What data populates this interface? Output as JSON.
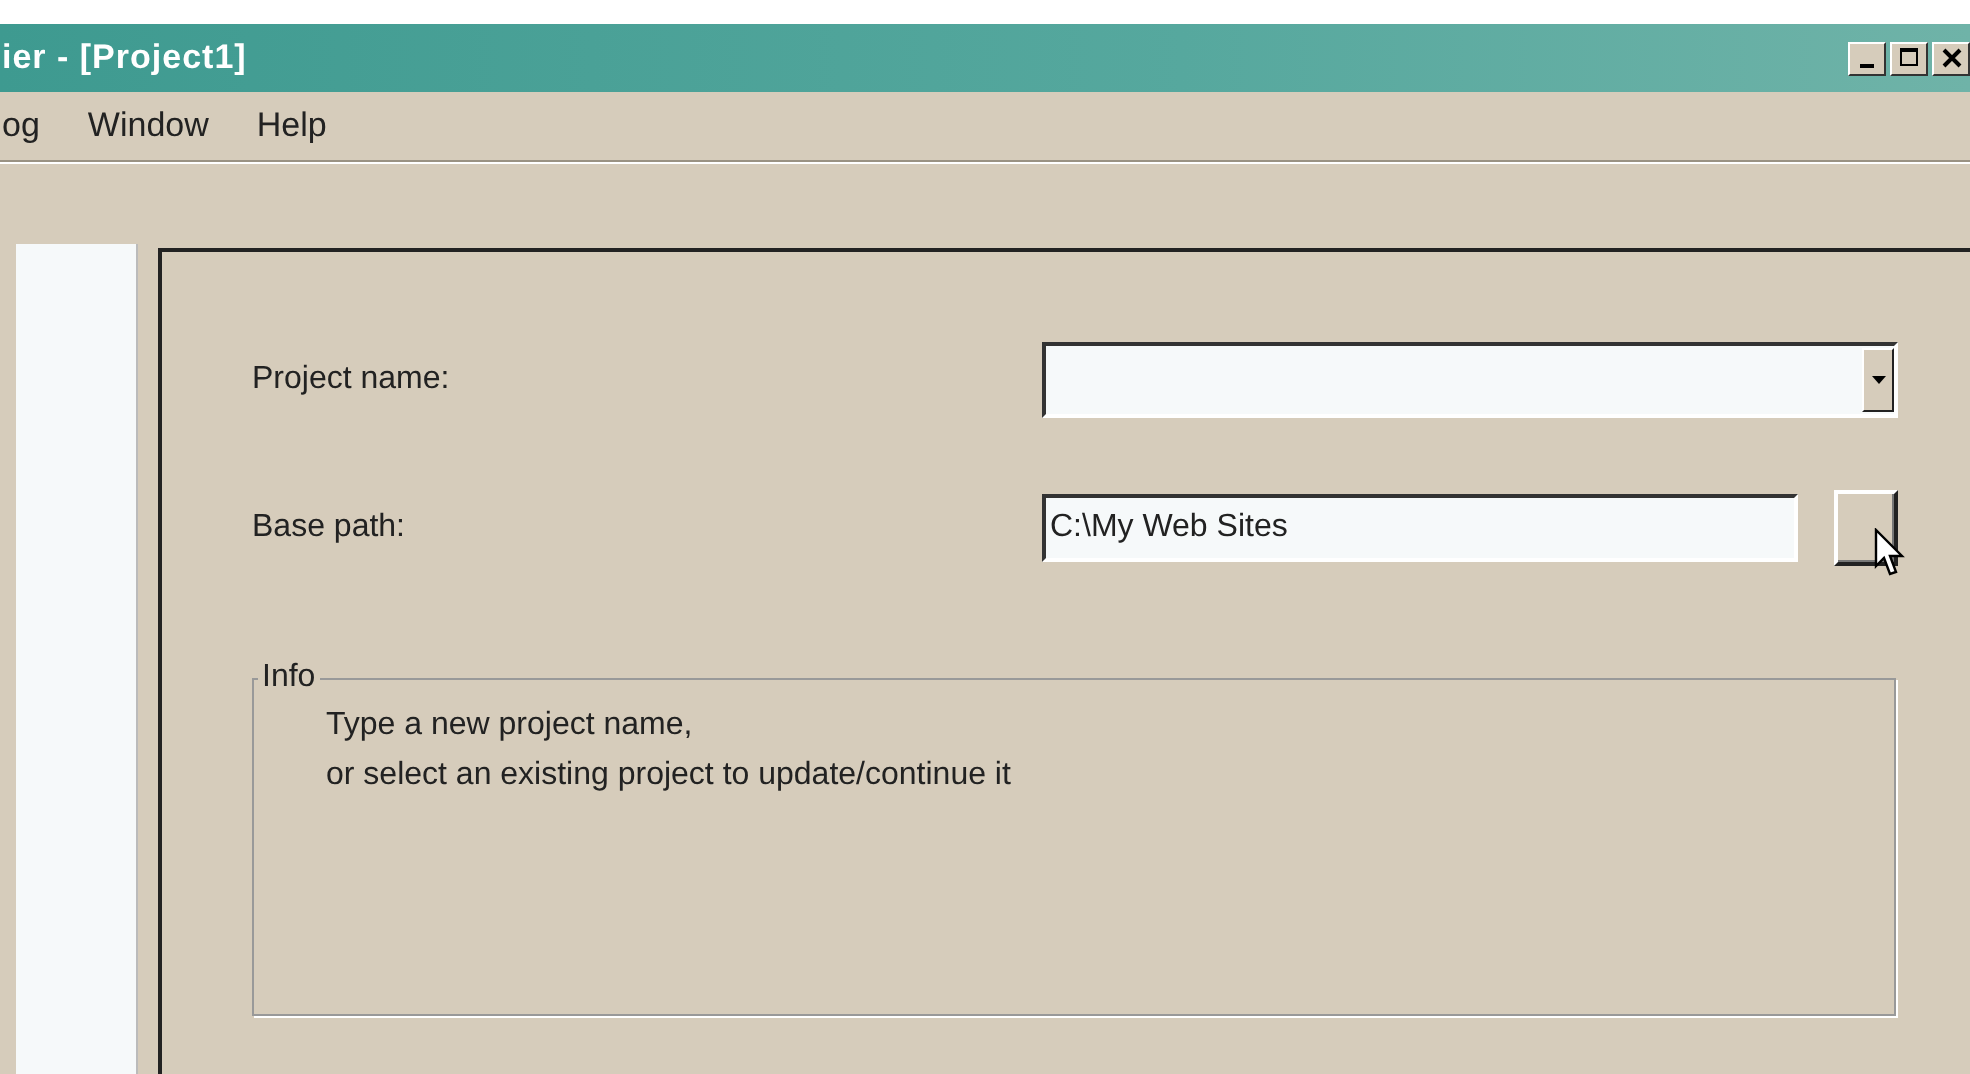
{
  "window": {
    "title": "ier - [Project1]"
  },
  "menu": [
    {
      "label": "og"
    },
    {
      "label": "Window"
    },
    {
      "label": "Help"
    }
  ],
  "form": {
    "project_name": {
      "label": "Project name:"
    },
    "base_path": {
      "label": "Base path:",
      "value": "C:\\My Web Sites"
    }
  },
  "info": {
    "title": "Info",
    "lines": [
      "Type a new project name,",
      "or select an existing project to update/continue it"
    ]
  }
}
